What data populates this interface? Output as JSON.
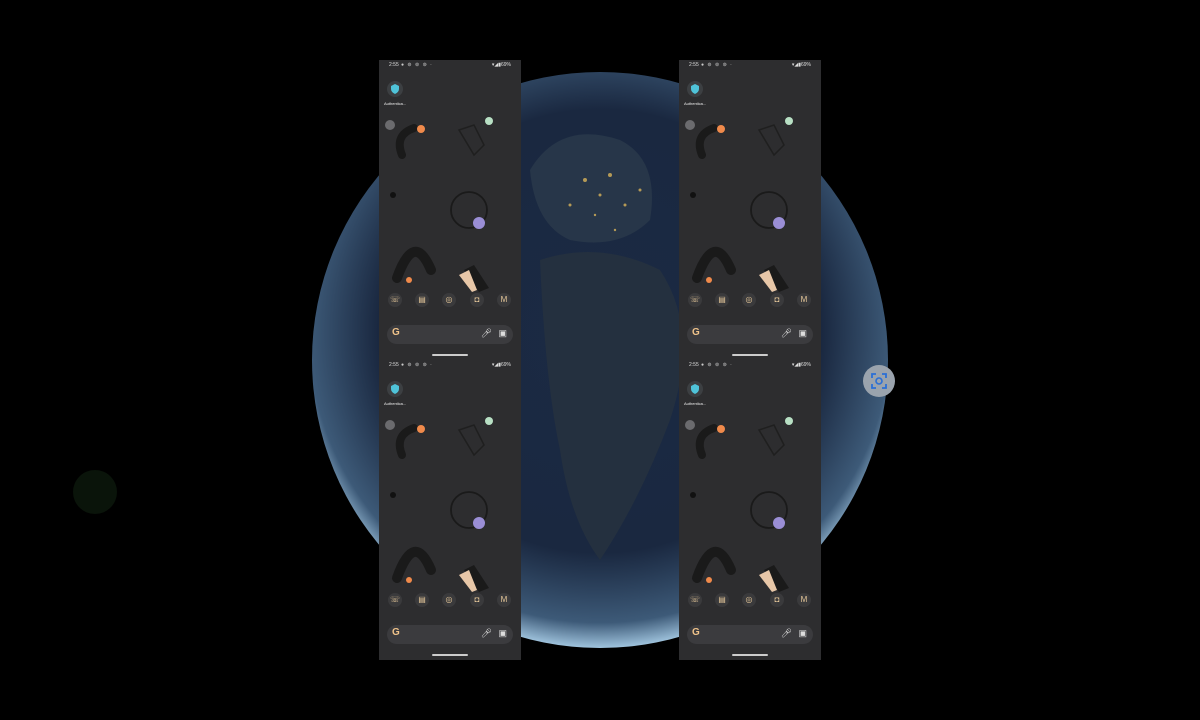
{
  "status_bar": {
    "time": "2:55",
    "battery": "69%"
  },
  "app": {
    "label": "Authentica...",
    "icon": "authenticator-shield-icon"
  },
  "dock": [
    "phone-icon",
    "messages-icon",
    "chrome-icon",
    "camera-icon",
    "gmail-icon"
  ],
  "search_bar": {
    "logo": "G",
    "icons": [
      "mic-icon",
      "lens-icon"
    ]
  },
  "tiles": [
    "top-left",
    "top-right",
    "bottom-left",
    "bottom-right"
  ],
  "colors": {
    "phone_bg": "#2d2d2f",
    "accent_orange": "#f08a4b",
    "accent_purple": "#9a8ed6",
    "accent_green": "#b8e0c4"
  },
  "screenshot_button": {
    "icon": "screenshot-icon"
  }
}
